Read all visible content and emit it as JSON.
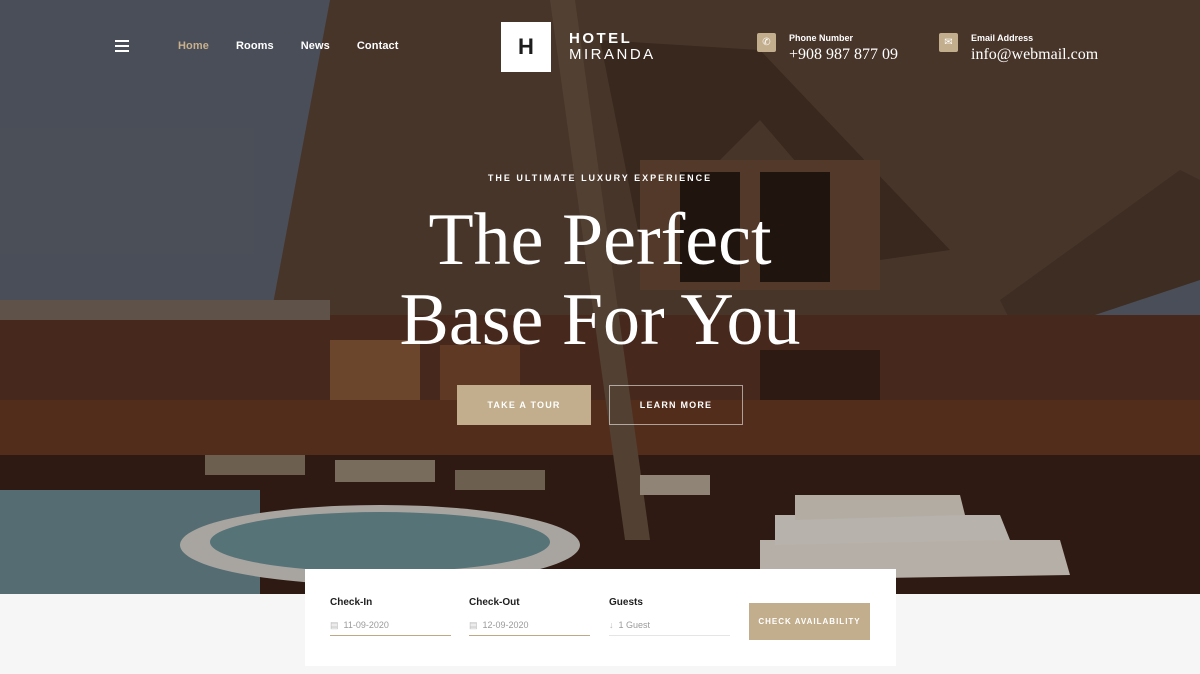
{
  "header": {
    "nav": [
      "Home",
      "Rooms",
      "News",
      "Contact"
    ],
    "logo_mark": "H",
    "logo_line1": "HOTEL",
    "logo_line2": "MIRANDA",
    "phone": {
      "label": "Phone Number",
      "value": "+908 987 877 09",
      "icon": "phone-icon"
    },
    "email": {
      "label": "Email Address",
      "value": "info@webmail.com",
      "icon": "envelope-icon"
    }
  },
  "hero": {
    "eyebrow": "THE ULTIMATE LUXURY EXPERIENCE",
    "title_line1": "The Perfect",
    "title_line2": "Base For You",
    "primary_button": "TAKE A TOUR",
    "secondary_button": "LEARN MORE"
  },
  "booking": {
    "checkin_label": "Check-In",
    "checkin_value": "11-09-2020",
    "checkout_label": "Check-Out",
    "checkout_value": "12-09-2020",
    "guests_label": "Guests",
    "guests_value": "1 Guest",
    "button": "CHECK AVAILABILITY"
  },
  "colors": {
    "accent": "#c2ad8c",
    "page_bg": "#f6f6f6"
  }
}
